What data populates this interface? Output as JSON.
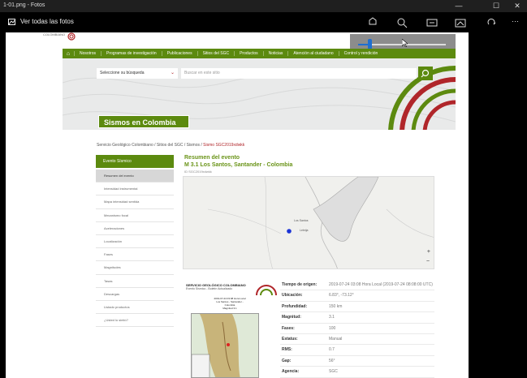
{
  "window": {
    "title": "1-01.png - Fotos",
    "controls": [
      "—",
      "☐",
      "✕"
    ]
  },
  "toolbar": {
    "back_label": "Ver todas las fotos",
    "icons": [
      "share-icon",
      "zoom-icon",
      "slideshow-icon",
      "edit-icon",
      "rotate-icon",
      "more-icon"
    ],
    "more_label": "···"
  },
  "zoom": {
    "level": 0.12
  },
  "site": {
    "logo_text": "COLOMBIANO",
    "nav": [
      "Nosotros",
      "Programas de investigación",
      "Publicaciones",
      "Sitios del SGC",
      "Productos",
      "Noticias",
      "Atención al ciudadano",
      "Control y rendición"
    ],
    "search": {
      "select_label": "Seleccione su búsqueda",
      "placeholder": "Buscar en este sitio"
    },
    "page_title": "Sismos en Colombia",
    "breadcrumb": {
      "trail": "Servicio Geológico Colombiano / Sitios del SGC / Sismos / ",
      "current": "Sismo SGC2019xdwkk"
    }
  },
  "sidebar": {
    "header": "Evento Sísmico",
    "items": [
      "Resumen del evento",
      "Intensidad instrumental",
      "Mapa intensidad sentida",
      "Mecanismo focal",
      "Aceleraciones",
      "Localización",
      "Fases",
      "Magnitudes",
      "Tasas",
      "Descargas",
      "Listado productos",
      "¿Usted lo sintió?"
    ]
  },
  "event": {
    "heading": "Resumen del evento",
    "subheading": "M 3.1 Los Santos, Santander - Colombia",
    "id": "ID SGC2019xdwkk",
    "map_labels": [
      "Los Santos",
      "Lebrija"
    ]
  },
  "report": {
    "header": "SERVICIO GEOLÓGICO COLOMBIANO",
    "subtitle": "Evento Sísmico - Boletín Actualizado",
    "summary": [
      "2019-07-24 03:08 Hora Local",
      "Los Santos - Santander - Colombia",
      "Magnitud 3.1"
    ]
  },
  "details": [
    {
      "label": "Tiempo de origen:",
      "value": "2019-07-24 03:08 Hora Local (2019-07-24 08:08:00 UTC)"
    },
    {
      "label": "Ubicación:",
      "value": "6.83°, -73.12°"
    },
    {
      "label": "Profundidad:",
      "value": "150 km"
    },
    {
      "label": "Magnitud:",
      "value": "3.1"
    },
    {
      "label": "Fases:",
      "value": "100"
    },
    {
      "label": "Estatus:",
      "value": "Manual"
    },
    {
      "label": "RMS:",
      "value": "0.7"
    },
    {
      "label": "Gap:",
      "value": "56°"
    },
    {
      "label": "Agencia:",
      "value": "SGC"
    }
  ],
  "colors": {
    "green": "#5c8a0f",
    "red": "#b0262a",
    "accent_blue": "#1f6fd1"
  }
}
